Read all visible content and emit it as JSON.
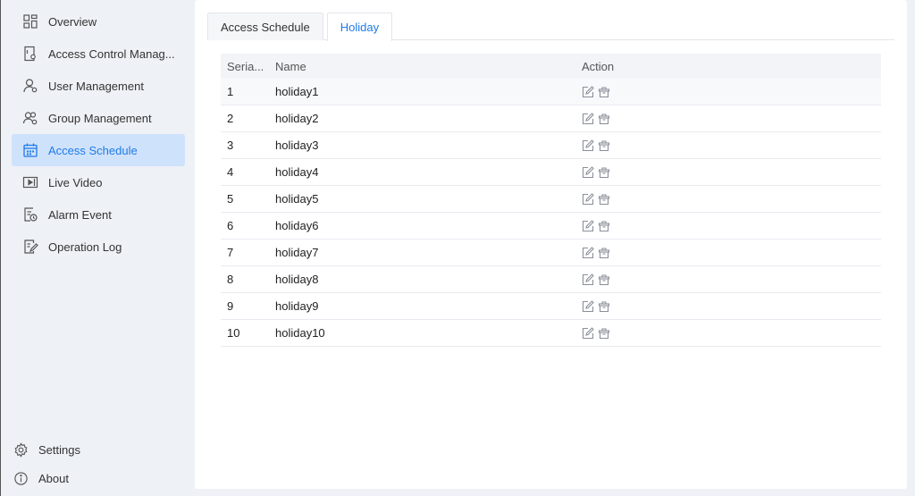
{
  "sidebar": {
    "items": [
      {
        "label": "Overview",
        "icon": "overview-icon"
      },
      {
        "label": "Access Control Manag...",
        "icon": "access-control-icon"
      },
      {
        "label": "User Management",
        "icon": "user-icon"
      },
      {
        "label": "Group Management",
        "icon": "group-icon"
      },
      {
        "label": "Access Schedule",
        "icon": "calendar-icon",
        "active": true
      },
      {
        "label": "Live Video",
        "icon": "video-icon"
      },
      {
        "label": "Alarm Event",
        "icon": "alarm-event-icon"
      },
      {
        "label": "Operation Log",
        "icon": "log-icon"
      }
    ],
    "bottom": [
      {
        "label": "Settings",
        "icon": "gear-icon"
      },
      {
        "label": "About",
        "icon": "info-icon"
      }
    ]
  },
  "tabs": [
    {
      "label": "Access Schedule",
      "active": false
    },
    {
      "label": "Holiday",
      "active": true
    }
  ],
  "table": {
    "headers": {
      "serial": "Seria...",
      "name": "Name",
      "action": "Action"
    },
    "rows": [
      {
        "serial": "1",
        "name": "holiday1"
      },
      {
        "serial": "2",
        "name": "holiday2"
      },
      {
        "serial": "3",
        "name": "holiday3"
      },
      {
        "serial": "4",
        "name": "holiday4"
      },
      {
        "serial": "5",
        "name": "holiday5"
      },
      {
        "serial": "6",
        "name": "holiday6"
      },
      {
        "serial": "7",
        "name": "holiday7"
      },
      {
        "serial": "8",
        "name": "holiday8"
      },
      {
        "serial": "9",
        "name": "holiday9"
      },
      {
        "serial": "10",
        "name": "holiday10"
      }
    ]
  },
  "colors": {
    "accent": "#1f7ae6",
    "active_bg": "#cfe2fb",
    "icon_gray": "#8a8f99"
  }
}
